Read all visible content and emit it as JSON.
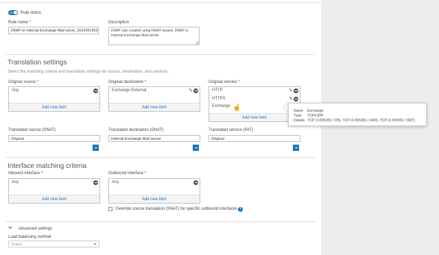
{
  "rule_status": {
    "label": "Rule status",
    "toggle_text": "ON"
  },
  "rule_name": {
    "label": "Rule name *",
    "value": "DNAT to Internal Exchange Mail serve_1624391353"
  },
  "description": {
    "label": "Description",
    "value": "DNAT rule created using DNAT wizard. DNAT to Internal Exchange Mail server"
  },
  "translation": {
    "title": "Translation settings",
    "subtitle": "Select the matching criteria and translation settings for source, destination, and services.",
    "original_source": {
      "label": "Original source *",
      "items": [
        "Any"
      ],
      "add_label": "Add new item"
    },
    "original_destination": {
      "label": "Original destination *",
      "items": [
        "Exchange External"
      ],
      "add_label": "Add new item"
    },
    "original_service": {
      "label": "Original service *",
      "items": [
        "HTTP",
        "HTTPS",
        "Exchange"
      ],
      "add_label": "Add new item"
    },
    "translated_source": {
      "label": "Translated source (SNAT)",
      "value": "Original"
    },
    "translated_destination": {
      "label": "Translated destination (DNAT)",
      "value": "Internal Exchange Mail server"
    },
    "translated_service": {
      "label": "Translated service (PAT)",
      "value": "Original"
    }
  },
  "interface": {
    "title": "Interface matching criteria",
    "inbound": {
      "label": "Inbound interface *",
      "items": [
        "Any"
      ],
      "add_label": "Add new item"
    },
    "outbound": {
      "label": "Outbound interface *",
      "items": [
        "Any"
      ],
      "add_label": "Add new item"
    },
    "override_label": "Override source translation (SNAT) for specific outbound interfaces",
    "info_icon_text": "i"
  },
  "advanced": {
    "label": "Advanced settings",
    "lb_label": "Load balancing method",
    "lb_placeholder": "Select"
  },
  "tooltip": {
    "name_key": "Name",
    "name_value": "Exchange",
    "type_key": "Type",
    "type_value": "TCP/UDP",
    "details_key": "Details",
    "details_value": "TCP (1:65535) / (25), TCP (1:65535) / (443), TCP (1:65535) / (587)"
  },
  "colors": {
    "accent": "#1a73c4",
    "sidebar": "#ededed"
  }
}
